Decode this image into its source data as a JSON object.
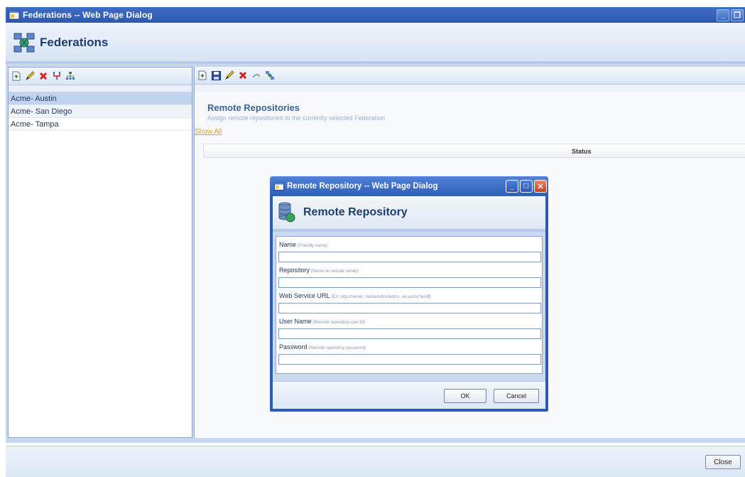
{
  "outer_window": {
    "title": "Federations -- Web Page Dialog",
    "header_title": "Federations",
    "restore_glyph": "❐",
    "minimize_glyph": "_"
  },
  "federations": {
    "items": [
      {
        "label": "Acme- Austin",
        "selected": true
      },
      {
        "label": "Acme- San Diego",
        "selected": false
      },
      {
        "label": "Acme- Tampa",
        "selected": false
      }
    ]
  },
  "left_toolbar": {
    "icons": [
      "new-icon",
      "edit-icon",
      "delete-icon",
      "move-icon",
      "hierarchy-icon"
    ]
  },
  "right_toolbar": {
    "icons": [
      "new-icon",
      "save-icon",
      "edit-icon",
      "delete-icon",
      "sync-icon",
      "repositories-icon"
    ]
  },
  "remote_repositories": {
    "title": "Remote Repositories",
    "description": "Assign remote repositories to the currently selected Federation",
    "show_all": "Show All",
    "columns": [
      "Status"
    ]
  },
  "footer": {
    "close_label": "Close"
  },
  "modal": {
    "title": "Remote Repository -- Web Page Dialog",
    "header_title": "Remote Repository",
    "minimize_glyph": "_",
    "maximize_glyph": "□",
    "close_glyph": "✕",
    "fields": [
      {
        "label": "Name",
        "hint": "(Friendly name)",
        "value": ""
      },
      {
        "label": "Repository",
        "hint": "(Name on remote server)",
        "value": ""
      },
      {
        "label": "Web Service URL",
        "hint": "(EX: http://server_name/edms/edms_ws.asmx?wsdl)",
        "value": ""
      },
      {
        "label": "User Name",
        "hint": "(Remote repository user ID)",
        "value": ""
      },
      {
        "label": "Password",
        "hint": "(Remote repository password)",
        "value": ""
      }
    ],
    "ok_label": "OK",
    "cancel_label": "Cancel"
  },
  "colors": {
    "titlebar": "#2c58ad",
    "header_text": "#1e3f6e",
    "selected_row": "#c1d4ef",
    "link": "#d89f21"
  }
}
